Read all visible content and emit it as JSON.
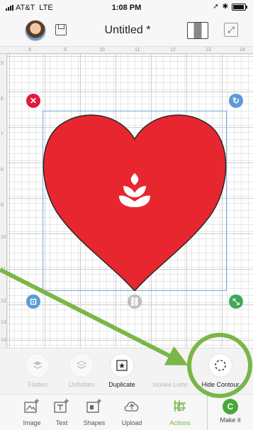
{
  "status_bar": {
    "carrier": "AT&T",
    "network": "LTE",
    "time": "1:08 PM"
  },
  "header": {
    "title": "Untitled *"
  },
  "rulers": {
    "top": [
      "8",
      "9",
      "10",
      "11",
      "12",
      "13",
      "14"
    ],
    "left": [
      "5",
      "6",
      "7",
      "8",
      "9",
      "10",
      "11",
      "12",
      "13",
      "14"
    ]
  },
  "actions": {
    "flatten": "Flatten",
    "unflatten": "Unflatten",
    "duplicate": "Duplicate",
    "isolate_letters": "Isolate Lette",
    "hide_contour": "Hide Contour"
  },
  "tabs": {
    "image": "Image",
    "text": "Text",
    "shapes": "Shapes",
    "upload": "Upload",
    "actions": "Actions",
    "make_it": "Make it"
  },
  "colors": {
    "heart": "#e8262f",
    "active_tab": "#7ab648",
    "annotation": "#7ab648",
    "make_it": "#48a83c"
  }
}
